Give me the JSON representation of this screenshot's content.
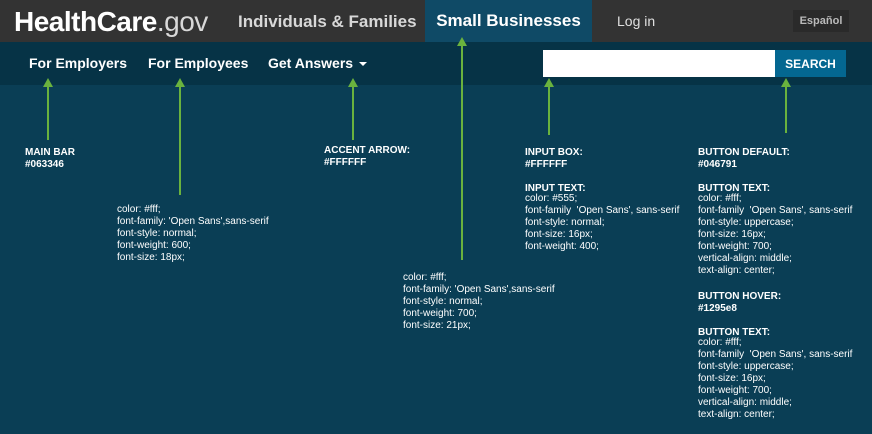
{
  "topbar": {
    "logo_bold": "HealthCare",
    "logo_light": ".gov",
    "tab_individuals": "Individuals & Families",
    "tab_small_businesses": "Small Businesses",
    "login": "Log in",
    "language": "Español"
  },
  "mainbar": {
    "nav": [
      "For Employers",
      "For Employees",
      "Get Answers"
    ],
    "search_button": "SEARCH",
    "search_value": ""
  },
  "annotations": {
    "main_bar": "MAIN BAR\n#063346",
    "nav_text": "color: #fff;\nfont-family: 'Open Sans',sans-serif\nfont-style: normal;\nfont-weight: 600;\nfont-size: 18px;",
    "accent_arrow": "ACCENT ARROW:\n#FFFFFF",
    "tab_text": "color: #fff;\nfont-family: 'Open Sans',sans-serif\nfont-style: normal;\nfont-weight: 700;\nfont-size: 21px;",
    "input_box_head": "INPUT BOX:\n#FFFFFF\n\nINPUT TEXT:",
    "input_box_body": "color: #555;\nfont-family  'Open Sans', sans-serif\nfont-style: normal;\nfont-size: 16px;\nfont-weight: 400;",
    "button_default_head": "BUTTON DEFAULT:\n#046791\n\nBUTTON TEXT:",
    "button_default_body": "color: #fff;\nfont-family  'Open Sans', sans-serif\nfont-style: uppercase;\nfont-size: 16px;\nfont-weight: 700;\nvertical-align: middle;\ntext-align: center;",
    "button_hover_head": "BUTTON HOVER:\n#1295e8\n\nBUTTON TEXT:",
    "button_hover_body": "color: #fff;\nfont-family  'Open Sans', sans-serif\nfont-style: uppercase;\nfont-size: 16px;\nfont-weight: 700;\nvertical-align: middle;\ntext-align: center;"
  },
  "colors": {
    "main_bar": "#063346",
    "button_default": "#046791",
    "button_hover": "#1295e8",
    "arrow": "#6ab23e"
  }
}
